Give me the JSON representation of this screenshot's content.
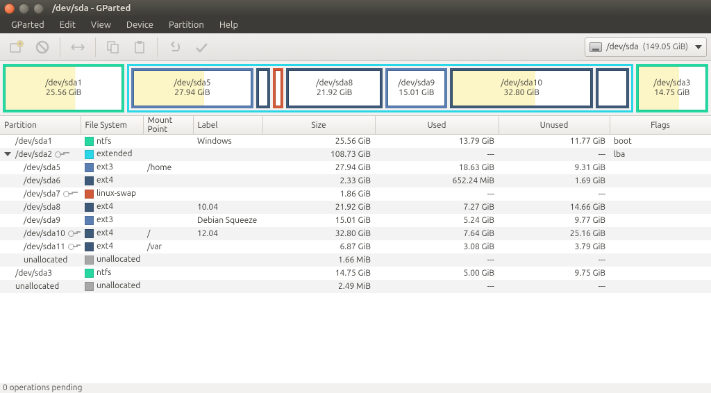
{
  "window": {
    "title": "/dev/sda - GParted"
  },
  "menubar": {
    "items": [
      "GParted",
      "Edit",
      "View",
      "Device",
      "Partition",
      "Help"
    ]
  },
  "device_selector": {
    "path": "/dev/sda",
    "size": "(149.05 GiB)"
  },
  "diskmap": [
    {
      "name": "/dev/sda1",
      "size": "25.56 GiB",
      "border": "b-ntfs",
      "fill": "map-yellow",
      "flex": 172
    },
    {
      "name": "extended",
      "border": "b-extd",
      "flex": 734,
      "children": [
        {
          "name": "/dev/sda5",
          "size": "27.94 GiB",
          "border": "b-ext3",
          "fill": "map-yellow",
          "flex": 188
        },
        {
          "name": "",
          "size": "",
          "border": "b-ext4",
          "fill": "map-white",
          "flex": 16
        },
        {
          "name": "",
          "size": "",
          "border": "b-swap",
          "fill": "map-white",
          "flex": 10
        },
        {
          "name": "/dev/sda8",
          "size": "21.92 GiB",
          "border": "b-ext4",
          "fill": "map-white",
          "flex": 148
        },
        {
          "name": "/dev/sda9",
          "size": "15.01 GiB",
          "border": "b-ext3",
          "fill": "map-white",
          "flex": 92
        },
        {
          "name": "/dev/sda10",
          "size": "32.80 GiB",
          "border": "b-ext4",
          "fill": "map-yellow",
          "flex": 222
        },
        {
          "name": "",
          "size": "",
          "border": "b-ext4",
          "fill": "map-white",
          "flex": 46
        }
      ]
    },
    {
      "name": "/dev/sda3",
      "size": "14.75 GiB",
      "border": "b-ntfs",
      "fill": "map-yellow",
      "flex": 100
    }
  ],
  "columns": {
    "partition": "Partition",
    "filesystem": "File System",
    "mountpoint": "Mount Point",
    "label": "Label",
    "size": "Size",
    "used": "Used",
    "unused": "Unused",
    "flags": "Flags"
  },
  "rows": [
    {
      "part": "/dev/sda1",
      "indent": 1,
      "key": false,
      "fs": "ntfs",
      "swatch": "sw-ntfs",
      "mp": "",
      "label": "Windows",
      "size": "25.56 GiB",
      "used": "13.79 GiB",
      "unused": "11.77 GiB",
      "flags": "boot"
    },
    {
      "part": "/dev/sda2",
      "indent": 0,
      "tri": true,
      "key": true,
      "fs": "extended",
      "swatch": "sw-extended",
      "mp": "",
      "label": "",
      "size": "108.73 GiB",
      "used": "---",
      "unused": "---",
      "flags": "lba"
    },
    {
      "part": "/dev/sda5",
      "indent": 2,
      "key": false,
      "fs": "ext3",
      "swatch": "sw-ext3",
      "mp": "/home",
      "label": "",
      "size": "27.94 GiB",
      "used": "18.63 GiB",
      "unused": "9.31 GiB",
      "flags": ""
    },
    {
      "part": "/dev/sda6",
      "indent": 2,
      "key": false,
      "fs": "ext4",
      "swatch": "sw-ext4",
      "mp": "",
      "label": "",
      "size": "2.33 GiB",
      "used": "652.24 MiB",
      "unused": "1.69 GiB",
      "flags": ""
    },
    {
      "part": "/dev/sda7",
      "indent": 2,
      "key": true,
      "fs": "linux-swap",
      "swatch": "sw-swap",
      "mp": "",
      "label": "",
      "size": "1.86 GiB",
      "used": "---",
      "unused": "---",
      "flags": ""
    },
    {
      "part": "/dev/sda8",
      "indent": 2,
      "key": false,
      "fs": "ext4",
      "swatch": "sw-ext4",
      "mp": "",
      "label": "10.04",
      "size": "21.92 GiB",
      "used": "7.27 GiB",
      "unused": "14.66 GiB",
      "flags": ""
    },
    {
      "part": "/dev/sda9",
      "indent": 2,
      "key": false,
      "fs": "ext3",
      "swatch": "sw-ext3",
      "mp": "",
      "label": "Debian Squeeze",
      "size": "15.01 GiB",
      "used": "5.24 GiB",
      "unused": "9.77 GiB",
      "flags": ""
    },
    {
      "part": "/dev/sda10",
      "indent": 2,
      "key": true,
      "fs": "ext4",
      "swatch": "sw-ext4",
      "mp": "/",
      "label": "12.04",
      "size": "32.80 GiB",
      "used": "7.64 GiB",
      "unused": "25.16 GiB",
      "flags": ""
    },
    {
      "part": "/dev/sda11",
      "indent": 2,
      "key": true,
      "fs": "ext4",
      "swatch": "sw-ext4",
      "mp": "/var",
      "label": "",
      "size": "6.87 GiB",
      "used": "3.08 GiB",
      "unused": "3.79 GiB",
      "flags": ""
    },
    {
      "part": "unallocated",
      "indent": 2,
      "key": false,
      "fs": "unallocated",
      "swatch": "sw-unalloc",
      "mp": "",
      "label": "",
      "size": "1.66 MiB",
      "used": "---",
      "unused": "---",
      "flags": ""
    },
    {
      "part": "/dev/sda3",
      "indent": 1,
      "key": false,
      "fs": "ntfs",
      "swatch": "sw-ntfs",
      "mp": "",
      "label": "",
      "size": "14.75 GiB",
      "used": "5.00 GiB",
      "unused": "9.75 GiB",
      "flags": ""
    },
    {
      "part": "unallocated",
      "indent": 1,
      "key": false,
      "fs": "unallocated",
      "swatch": "sw-unalloc",
      "mp": "",
      "label": "",
      "size": "2.49 MiB",
      "used": "---",
      "unused": "---",
      "flags": ""
    }
  ],
  "statusbar": {
    "text": "0 operations pending"
  }
}
